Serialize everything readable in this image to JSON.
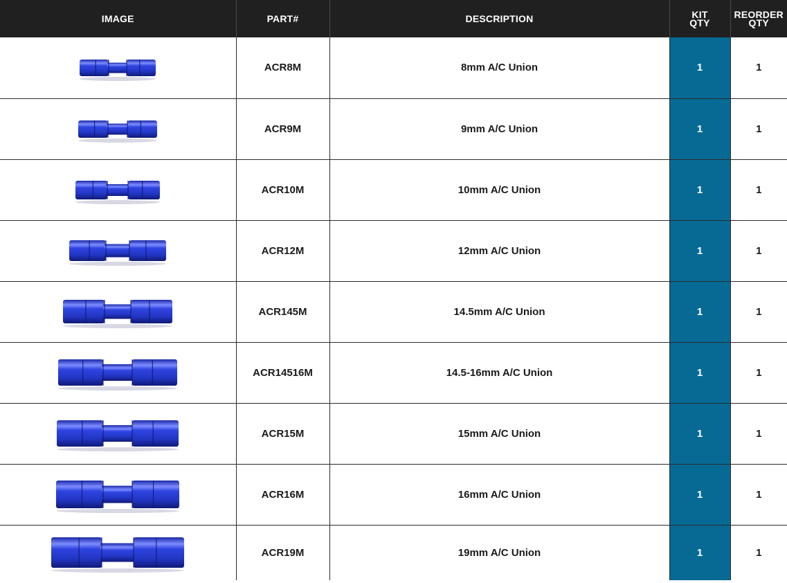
{
  "headers": {
    "image": "IMAGE",
    "part": "PART#",
    "description": "DESCRIPTION",
    "kit_qty_l1": "KIT",
    "kit_qty_l2": "QTY",
    "reorder_qty_l1": "REORDER",
    "reorder_qty_l2": "QTY"
  },
  "rows": [
    {
      "part": "ACR8M",
      "description": "8mm A/C Union",
      "kit_qty": "1",
      "reorder_qty": "1",
      "image_icon": "blue-union-fitting-icon"
    },
    {
      "part": "ACR9M",
      "description": "9mm A/C Union",
      "kit_qty": "1",
      "reorder_qty": "1",
      "image_icon": "blue-union-fitting-icon"
    },
    {
      "part": "ACR10M",
      "description": "10mm A/C Union",
      "kit_qty": "1",
      "reorder_qty": "1",
      "image_icon": "blue-union-fitting-icon"
    },
    {
      "part": "ACR12M",
      "description": "12mm A/C Union",
      "kit_qty": "1",
      "reorder_qty": "1",
      "image_icon": "blue-union-fitting-icon"
    },
    {
      "part": "ACR145M",
      "description": "14.5mm A/C Union",
      "kit_qty": "1",
      "reorder_qty": "1",
      "image_icon": "blue-union-fitting-icon"
    },
    {
      "part": "ACR14516M",
      "description": "14.5-16mm A/C Union",
      "kit_qty": "1",
      "reorder_qty": "1",
      "image_icon": "blue-union-fitting-icon"
    },
    {
      "part": "ACR15M",
      "description": "15mm A/C Union",
      "kit_qty": "1",
      "reorder_qty": "1",
      "image_icon": "blue-union-fitting-icon"
    },
    {
      "part": "ACR16M",
      "description": "16mm A/C Union",
      "kit_qty": "1",
      "reorder_qty": "1",
      "image_icon": "blue-union-fitting-icon"
    },
    {
      "part": "ACR19M",
      "description": "19mm A/C Union",
      "kit_qty": "1",
      "reorder_qty": "1",
      "image_icon": "blue-union-fitting-icon"
    }
  ],
  "colors": {
    "header_bg": "#202020",
    "kit_qty_bg": "#066a94",
    "fitting_blue": "#2a3fd0"
  }
}
